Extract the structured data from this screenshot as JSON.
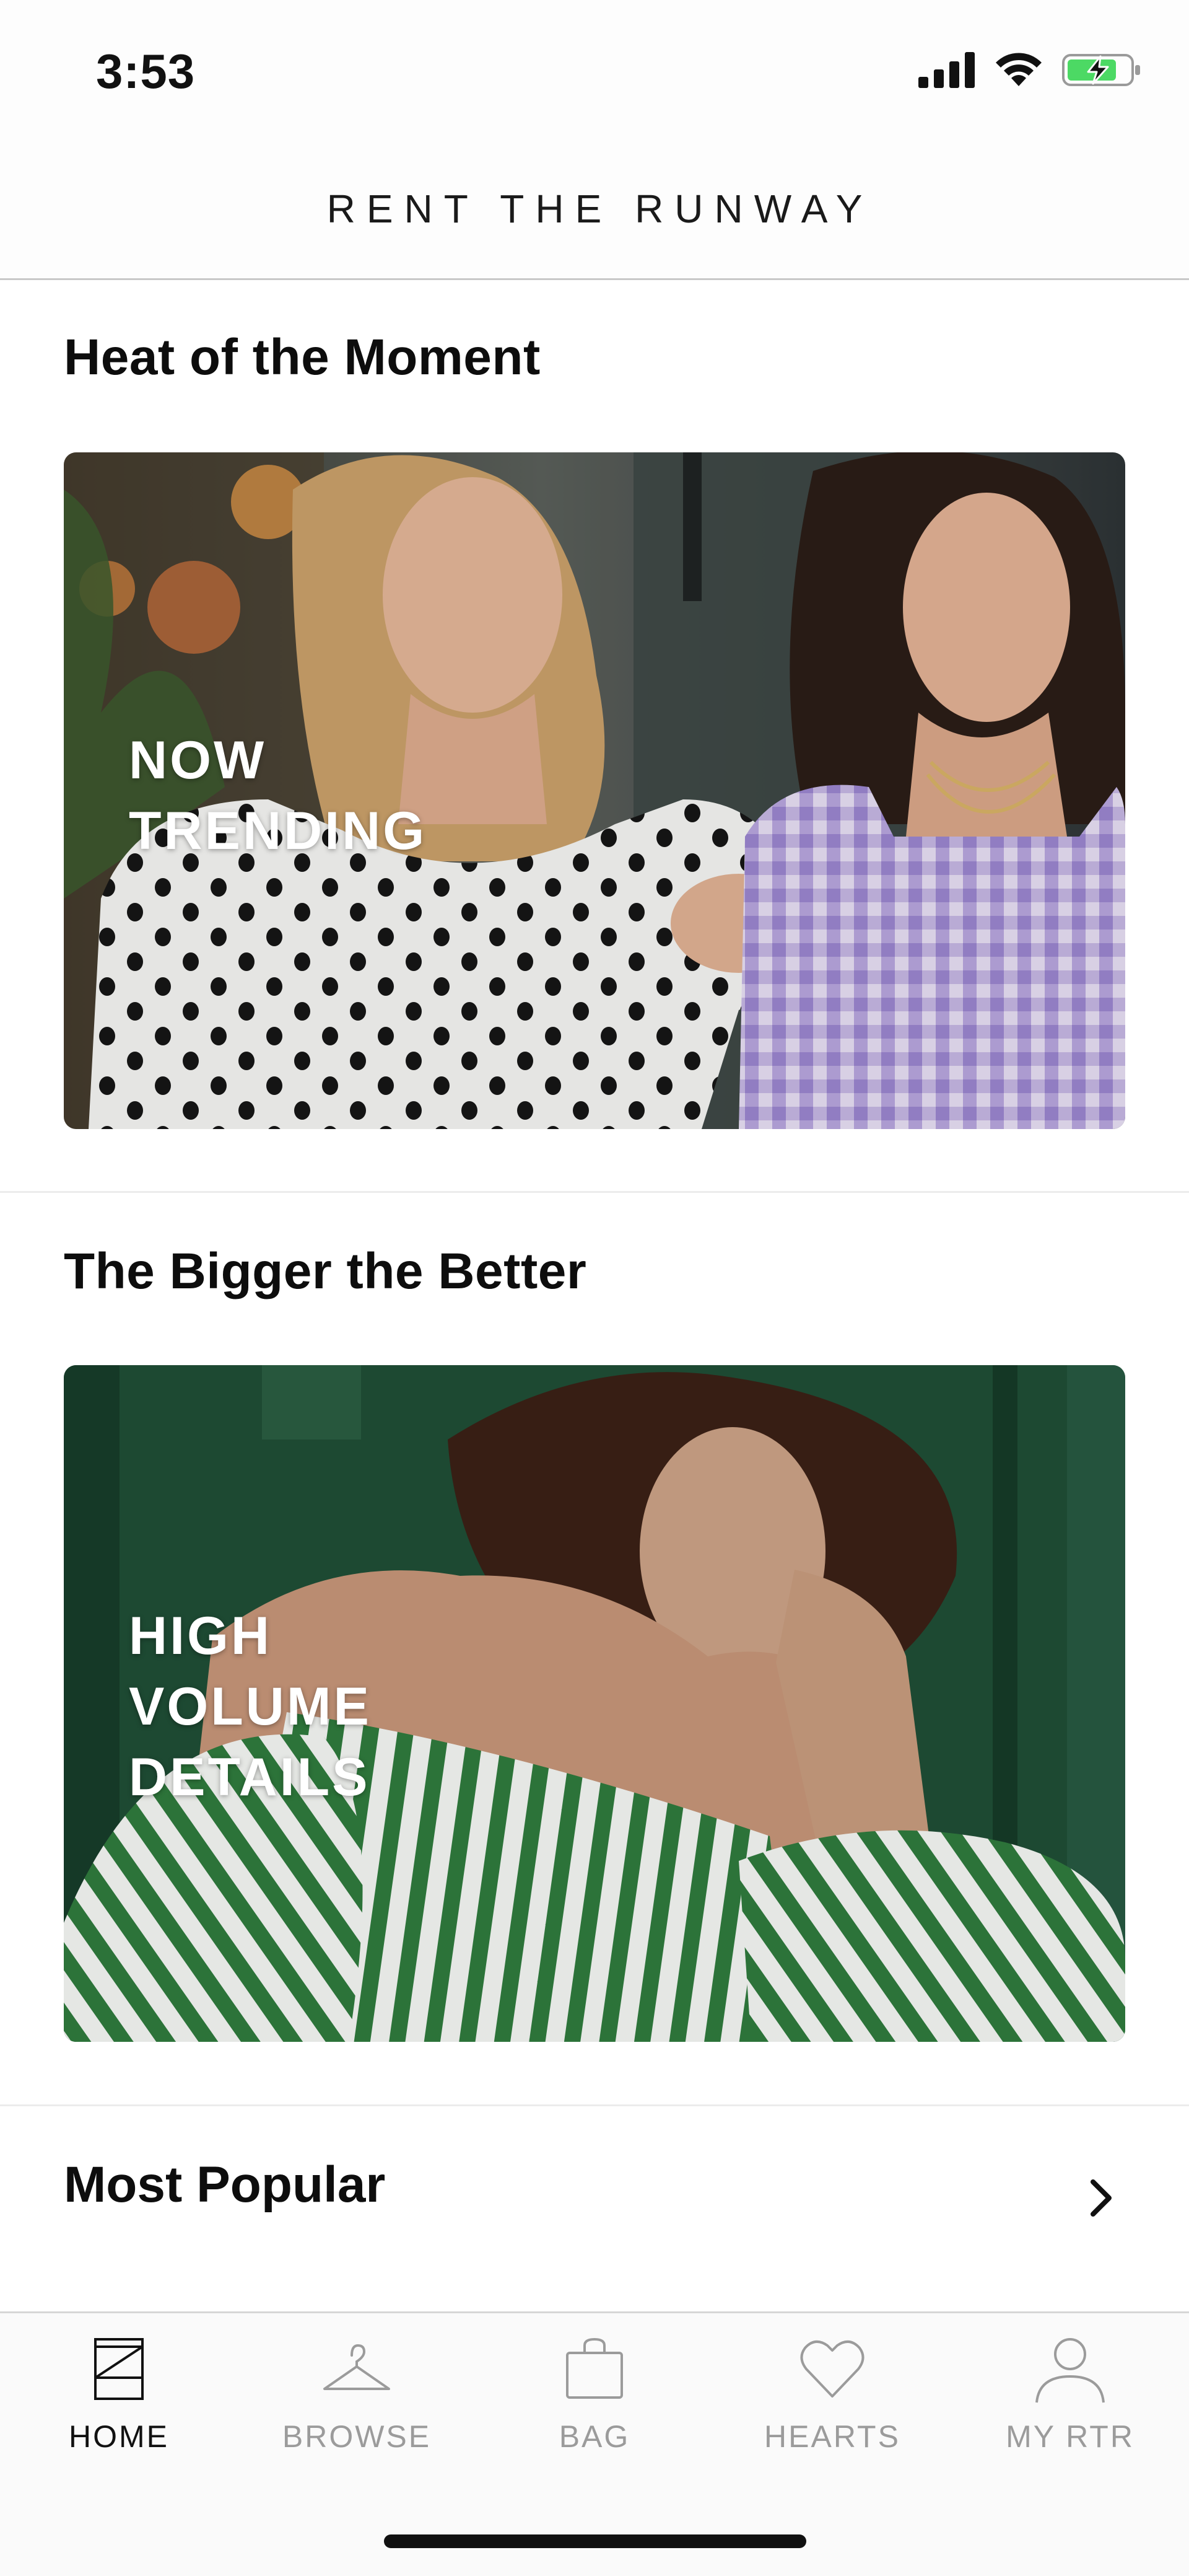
{
  "status_bar": {
    "time": "3:53",
    "icons": [
      "cellular-signal-icon",
      "wifi-icon",
      "battery-charging-icon"
    ],
    "battery_color": "#4cd964"
  },
  "header": {
    "brand": "RENT THE RUNWAY"
  },
  "sections": [
    {
      "title": "Heat of the Moment",
      "card_label_lines": [
        "NOW",
        "TRENDING"
      ]
    },
    {
      "title": "The Bigger the Better",
      "card_label_lines": [
        "HIGH",
        "VOLUME",
        "DETAILS"
      ]
    }
  ],
  "most_popular": {
    "title": "Most Popular",
    "icon": "chevron-right-icon"
  },
  "tab_bar": {
    "tabs": [
      {
        "label": "HOME",
        "icon": "home-icon",
        "active": true
      },
      {
        "label": "BROWSE",
        "icon": "hanger-icon",
        "active": false
      },
      {
        "label": "BAG",
        "icon": "bag-icon",
        "active": false
      },
      {
        "label": "HEARTS",
        "icon": "heart-icon",
        "active": false
      },
      {
        "label": "MY RTR",
        "icon": "person-icon",
        "active": false
      }
    ]
  },
  "colors": {
    "accent_green": "#1f4d35",
    "text": "#111111",
    "inactive_tab": "#9b9b9b"
  }
}
